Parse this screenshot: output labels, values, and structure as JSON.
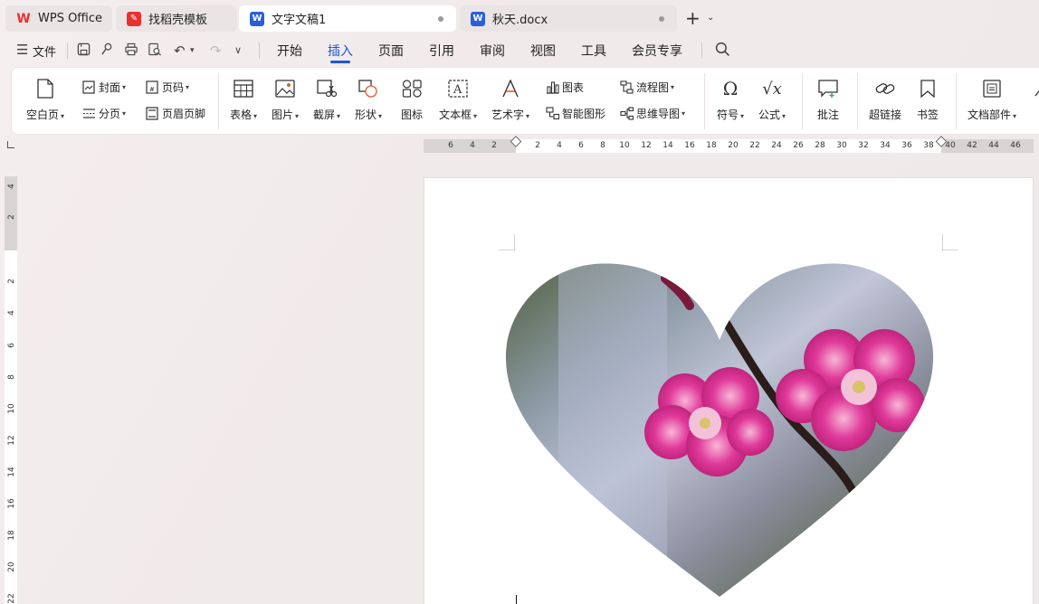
{
  "tabs": [
    {
      "label": "WPS Office",
      "active": false,
      "icon": "wps-logo-icon",
      "modified": false
    },
    {
      "label": "找稻壳模板",
      "active": false,
      "icon": "docer-icon",
      "modified": false
    },
    {
      "label": "文字文稿1",
      "active": true,
      "icon": "word-doc-icon",
      "modified": true
    },
    {
      "label": "秋天.docx",
      "active": false,
      "icon": "word-doc-icon",
      "modified": true
    }
  ],
  "menu": {
    "file_label": "文件",
    "items": [
      "开始",
      "插入",
      "页面",
      "引用",
      "审阅",
      "视图",
      "工具",
      "会员专享"
    ],
    "active": "插入"
  },
  "ribbon": {
    "blank_page": "空白页",
    "cover": "封面",
    "page_break": "分页",
    "page_number": "页码",
    "header_footer": "页眉页脚",
    "table": "表格",
    "picture": "图片",
    "screenshot": "截屏",
    "shape": "形状",
    "icon": "图标",
    "textbox": "文本框",
    "wordart": "艺术字",
    "chart": "图表",
    "smartart": "智能图形",
    "flowchart": "流程图",
    "mindmap": "思维导图",
    "symbol": "符号",
    "formula": "公式",
    "comment": "批注",
    "hyperlink": "超链接",
    "bookmark": "书签",
    "doc_parts": "文档部件"
  },
  "hruler_ticks": [
    "6",
    "4",
    "2",
    "2",
    "4",
    "6",
    "8",
    "10",
    "12",
    "14",
    "16",
    "18",
    "20",
    "22",
    "24",
    "26",
    "28",
    "30",
    "32",
    "34",
    "36",
    "38",
    "40",
    "42",
    "44",
    "46"
  ],
  "vruler_ticks": [
    "4",
    "2",
    "2",
    "4",
    "6",
    "8",
    "10",
    "12",
    "14",
    "16",
    "18",
    "20",
    "22"
  ],
  "colors": {
    "accent": "#1f55d6",
    "wps_red": "#e8312f",
    "word_blue": "#2b5fd9",
    "flower_pink": "#e0399a"
  }
}
